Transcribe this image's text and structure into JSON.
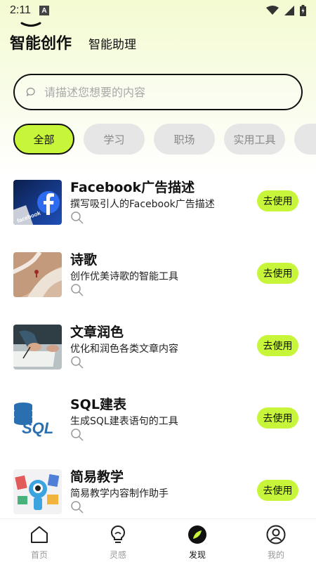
{
  "status_bar": {
    "time": "2:11",
    "notif_icon": "a-square-icon"
  },
  "header": {
    "tab_active": "智能创作",
    "tab_inactive": "智能助理"
  },
  "search": {
    "placeholder": "请描述您想要的内容"
  },
  "chips": [
    "全部",
    "学习",
    "职场",
    "实用工具"
  ],
  "items": [
    {
      "title": "Facebook广告描述",
      "desc": "撰写吸引人的Facebook广告描述",
      "button": "去使用"
    },
    {
      "title": "诗歌",
      "desc": "创作优美诗歌的智能工具",
      "button": "去使用"
    },
    {
      "title": "文章润色",
      "desc": "优化和润色各类文章内容",
      "button": "去使用"
    },
    {
      "title": "SQL建表",
      "desc": "生成SQL建表语句的工具",
      "button": "去使用"
    },
    {
      "title": "简易教学",
      "desc": "简易教学内容制作助手",
      "button": "去使用"
    }
  ],
  "thumbs": {
    "sql_text": "SQL",
    "facebook_text": "facebook"
  },
  "nav": [
    {
      "label": "首页",
      "icon": "home-icon"
    },
    {
      "label": "灵感",
      "icon": "lightbulb-icon"
    },
    {
      "label": "发现",
      "icon": "discover-icon"
    },
    {
      "label": "我的",
      "icon": "profile-icon"
    }
  ],
  "colors": {
    "accent": "#c7f53a",
    "chip_bg": "#e6e6e6",
    "text": "#111111"
  }
}
